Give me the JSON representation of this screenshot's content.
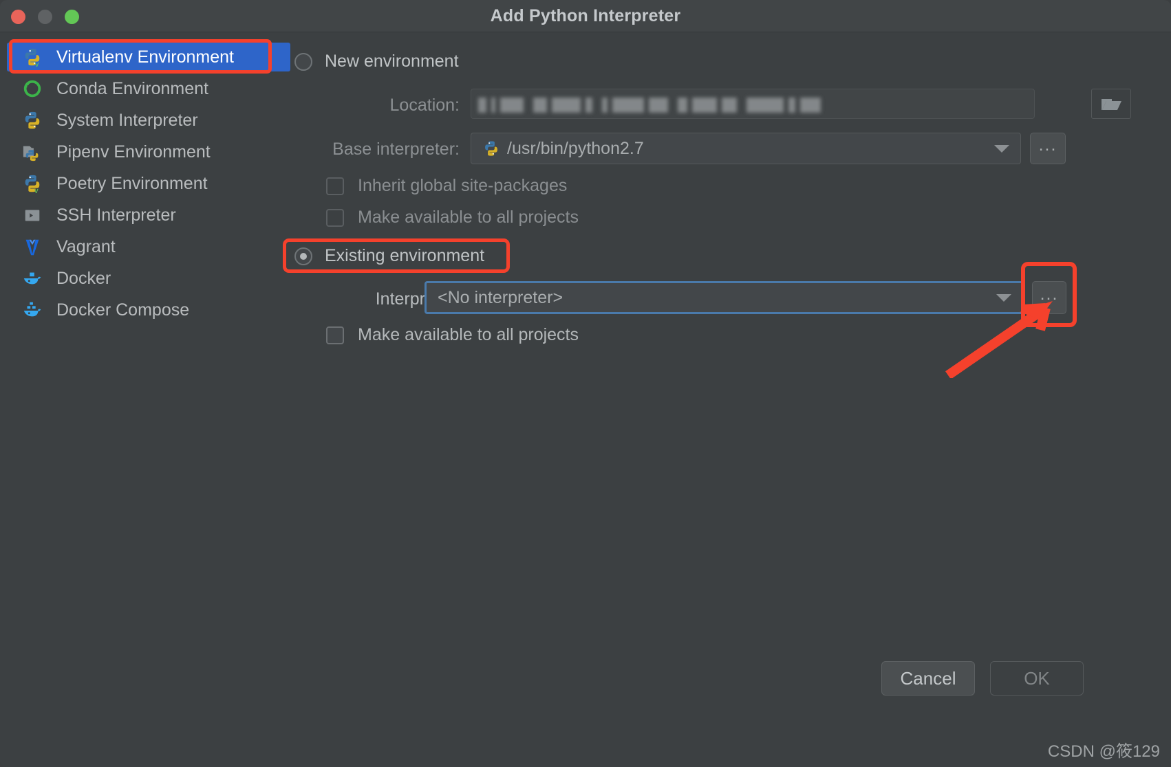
{
  "window": {
    "title": "Add Python Interpreter",
    "traffic_lights": [
      "close",
      "minimize",
      "zoom"
    ]
  },
  "sidebar": {
    "items": [
      {
        "label": "Virtualenv Environment",
        "icon": "python-venv-icon",
        "selected": true
      },
      {
        "label": "Conda Environment",
        "icon": "conda-icon",
        "selected": false
      },
      {
        "label": "System Interpreter",
        "icon": "python-icon",
        "selected": false
      },
      {
        "label": "Pipenv Environment",
        "icon": "pipenv-icon",
        "selected": false
      },
      {
        "label": "Poetry Environment",
        "icon": "poetry-icon",
        "selected": false
      },
      {
        "label": "SSH Interpreter",
        "icon": "ssh-terminal-icon",
        "selected": false
      },
      {
        "label": "Vagrant",
        "icon": "vagrant-icon",
        "selected": false
      },
      {
        "label": "Docker",
        "icon": "docker-icon",
        "selected": false
      },
      {
        "label": "Docker Compose",
        "icon": "docker-compose-icon",
        "selected": false
      }
    ]
  },
  "main": {
    "new_environment": {
      "radio_label": "New environment",
      "selected": false,
      "location": {
        "label": "Location:",
        "value": "",
        "redacted": true,
        "browse_icon": "folder-icon"
      },
      "base_interpreter": {
        "label": "Base interpreter:",
        "value": "/usr/bin/python2.7",
        "icon": "python-icon",
        "browse_label": "..."
      },
      "checkboxes": [
        {
          "label": "Inherit global site-packages",
          "checked": false,
          "enabled": false
        },
        {
          "label": "Make available to all projects",
          "checked": false,
          "enabled": false
        }
      ]
    },
    "existing_environment": {
      "radio_label": "Existing environment",
      "selected": true,
      "interpreter": {
        "label": "Interpreter:",
        "value": "<No interpreter>",
        "focused": true,
        "browse_label": "..."
      },
      "checkboxes": [
        {
          "label": "Make available to all projects",
          "checked": false,
          "enabled": true
        }
      ]
    }
  },
  "footer": {
    "cancel_label": "Cancel",
    "ok_label": "OK",
    "ok_enabled": false
  },
  "annotations": {
    "highlight_color": "#f5412c",
    "boxes": [
      "sidebar-virtualenv",
      "existing-environment-radio",
      "interpreter-browse-button"
    ],
    "arrow": "points-to-interpreter-browse-button"
  },
  "watermark": {
    "text": "CSDN @筱129"
  }
}
